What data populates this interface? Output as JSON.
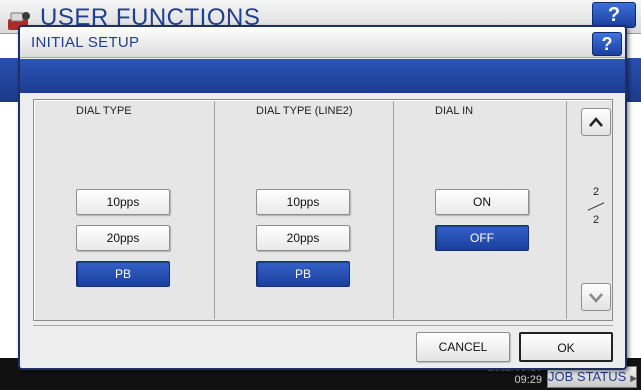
{
  "background": {
    "title": "USER FUNCTIONS",
    "help_label": "?",
    "date_partial": "2011.08.16",
    "time": "09:29",
    "job_status_label": "JOB STATUS"
  },
  "dialog": {
    "title": "INITIAL SETUP",
    "help_label": "?",
    "columns": [
      {
        "label": "DIAL TYPE",
        "options": [
          {
            "label": "10pps",
            "selected": false
          },
          {
            "label": "20pps",
            "selected": false
          },
          {
            "label": "PB",
            "selected": true
          }
        ]
      },
      {
        "label": "DIAL TYPE (LINE2)",
        "options": [
          {
            "label": "10pps",
            "selected": false
          },
          {
            "label": "20pps",
            "selected": false
          },
          {
            "label": "PB",
            "selected": true
          }
        ]
      },
      {
        "label": "DIAL IN",
        "options": [
          {
            "label": "ON",
            "selected": false
          },
          {
            "label": "OFF",
            "selected": true
          }
        ]
      }
    ],
    "pager": {
      "current": "2",
      "total": "2"
    },
    "cancel_label": "CANCEL",
    "ok_label": "OK"
  },
  "colors": {
    "accent_blue": "#1c3f9e",
    "title_text": "#1f3f8f"
  }
}
